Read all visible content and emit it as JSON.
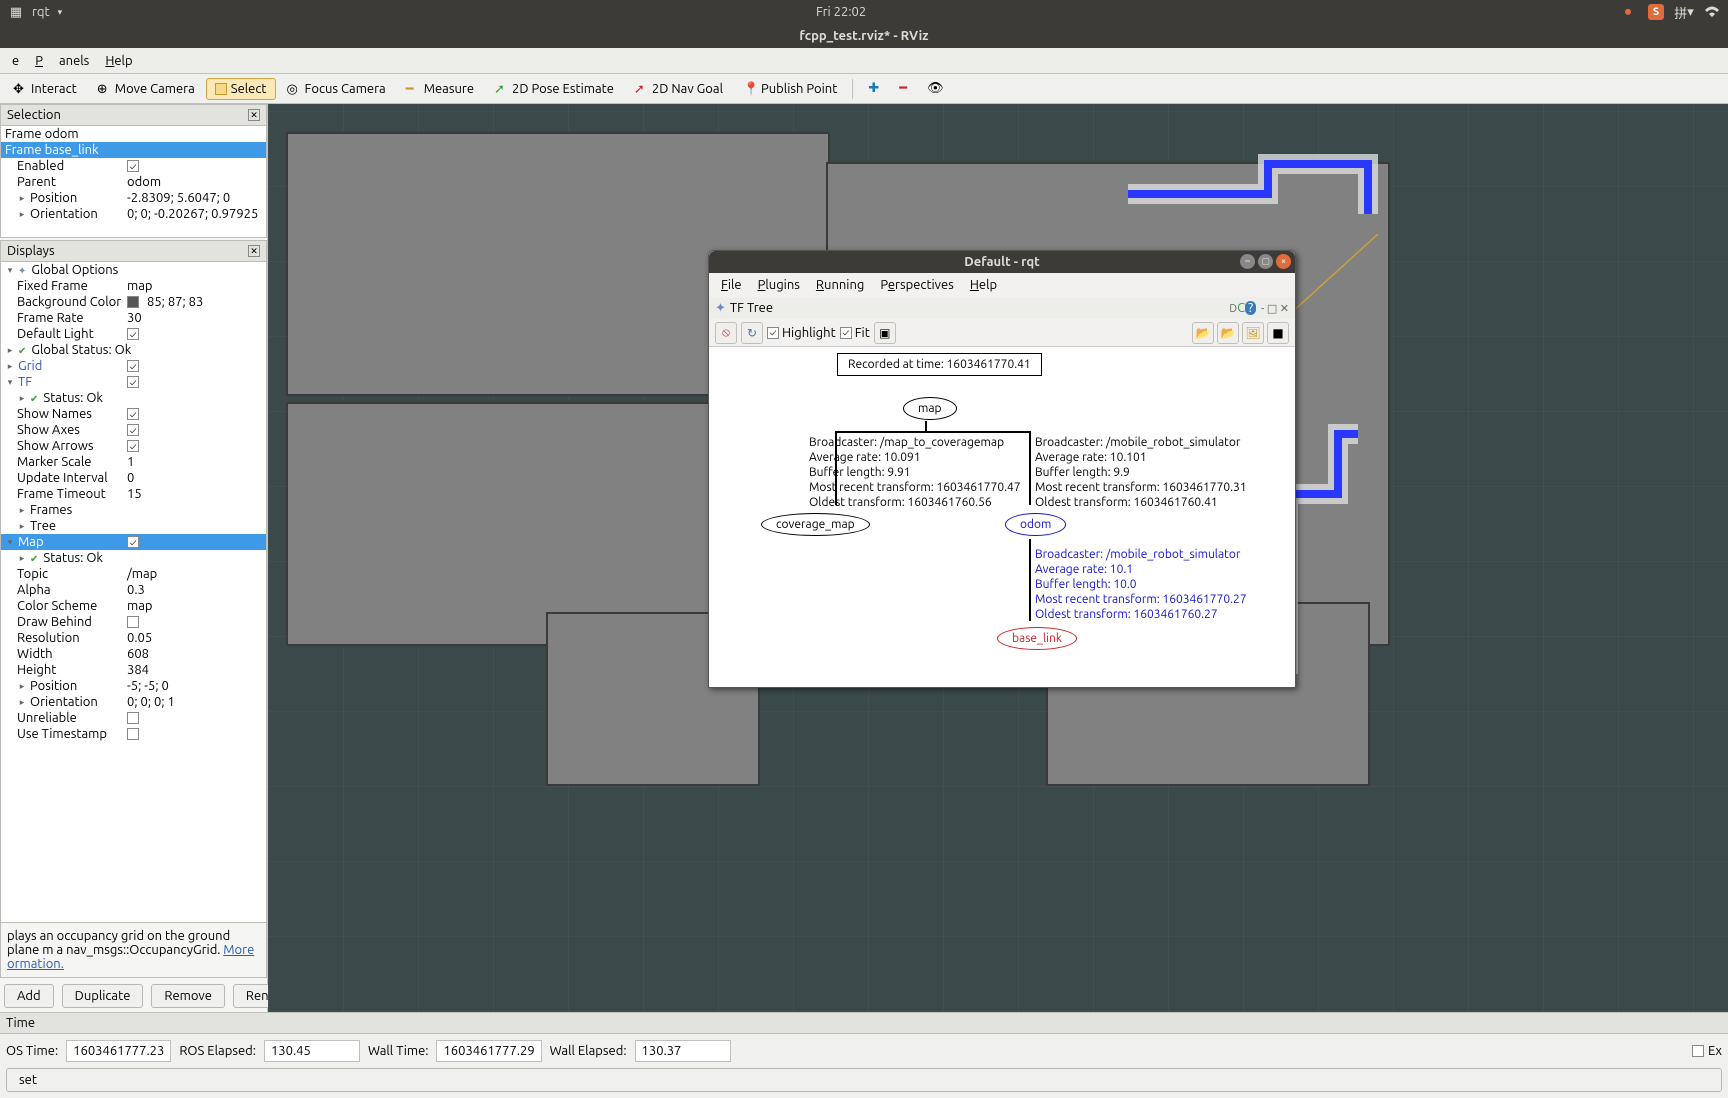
{
  "ubuntu": {
    "app": "rqt",
    "clock": "Fri 22:02",
    "ime": "拼"
  },
  "rviz_title": "fcpp_test.rviz* - RViz",
  "menubar": {
    "file": "e",
    "panels": "Panels",
    "help": "Help"
  },
  "toolbar": {
    "interact": "Interact",
    "move_camera": "Move Camera",
    "select": "Select",
    "focus_camera": "Focus Camera",
    "measure": "Measure",
    "pose_estimate": "2D Pose Estimate",
    "nav_goal": "2D Nav Goal",
    "publish_point": "Publish Point"
  },
  "selection": {
    "title": "Selection",
    "rows": [
      {
        "k": "Frame odom",
        "v": ""
      },
      {
        "k": "Frame base_link",
        "v": "",
        "sel": true
      },
      {
        "k": "Enabled",
        "v": "✓",
        "i": 1,
        "chk": true
      },
      {
        "k": "Parent",
        "v": "odom",
        "i": 1
      },
      {
        "k": "Position",
        "v": "-2.8309; 5.6047; 0",
        "i": 1,
        "exp": "▸"
      },
      {
        "k": "Orientation",
        "v": "0; 0; -0.20267; 0.97925",
        "i": 1,
        "exp": "▸"
      }
    ]
  },
  "displays": {
    "title": "Displays",
    "rows": [
      {
        "k": "Global Options",
        "v": "",
        "exp": "▾",
        "ico": "gear"
      },
      {
        "k": "Fixed Frame",
        "v": "map",
        "i": 1
      },
      {
        "k": "Background Color",
        "v": "85; 87; 83",
        "i": 1,
        "color": true
      },
      {
        "k": "Frame Rate",
        "v": "30",
        "i": 1
      },
      {
        "k": "Default Light",
        "v": "✓",
        "i": 1,
        "chk": true
      },
      {
        "k": "Global Status: Ok",
        "v": "",
        "exp": "▸",
        "ico": "ok"
      },
      {
        "k": "Grid",
        "v": "✓",
        "exp": "▸",
        "chk": true,
        "link": true
      },
      {
        "k": "TF",
        "v": "✓",
        "exp": "▾",
        "chk": true,
        "link": true
      },
      {
        "k": "Status: Ok",
        "v": "",
        "i": 1,
        "exp": "▸",
        "ico": "ok"
      },
      {
        "k": "Show Names",
        "v": "✓",
        "i": 1,
        "chk": true
      },
      {
        "k": "Show Axes",
        "v": "✓",
        "i": 1,
        "chk": true
      },
      {
        "k": "Show Arrows",
        "v": "✓",
        "i": 1,
        "chk": true
      },
      {
        "k": "Marker Scale",
        "v": "1",
        "i": 1
      },
      {
        "k": "Update Interval",
        "v": "0",
        "i": 1
      },
      {
        "k": "Frame Timeout",
        "v": "15",
        "i": 1
      },
      {
        "k": "Frames",
        "v": "",
        "i": 1,
        "exp": "▸"
      },
      {
        "k": "Tree",
        "v": "",
        "i": 1,
        "exp": "▸"
      },
      {
        "k": "Map",
        "v": "✓",
        "exp": "▾",
        "chk": true,
        "sel": true,
        "link": true
      },
      {
        "k": "Status: Ok",
        "v": "",
        "i": 1,
        "exp": "▸",
        "ico": "ok"
      },
      {
        "k": "Topic",
        "v": "/map",
        "i": 1
      },
      {
        "k": "Alpha",
        "v": "0.3",
        "i": 1
      },
      {
        "k": "Color Scheme",
        "v": "map",
        "i": 1
      },
      {
        "k": "Draw Behind",
        "v": "",
        "i": 1,
        "chk": true,
        "unchecked": true
      },
      {
        "k": "Resolution",
        "v": "0.05",
        "i": 1
      },
      {
        "k": "Width",
        "v": "608",
        "i": 1
      },
      {
        "k": "Height",
        "v": "384",
        "i": 1
      },
      {
        "k": "Position",
        "v": "-5; -5; 0",
        "i": 1,
        "exp": "▸"
      },
      {
        "k": "Orientation",
        "v": "0; 0; 0; 1",
        "i": 1,
        "exp": "▸"
      },
      {
        "k": "Unreliable",
        "v": "",
        "i": 1,
        "chk": true,
        "unchecked": true
      },
      {
        "k": "Use Timestamp",
        "v": "",
        "i": 1,
        "chk": true,
        "unchecked": true
      }
    ],
    "desc": "plays an occupancy grid on the ground plane m a nav_msgs::OccupancyGrid.",
    "desc_more": "More ormation.",
    "buttons": {
      "add": "Add",
      "duplicate": "Duplicate",
      "remove": "Remove",
      "rename": "Rename"
    }
  },
  "rqt": {
    "title": "Default - rqt",
    "menu": {
      "file": "File",
      "plugins": "Plugins",
      "running": "Running",
      "perspectives": "Perspectives",
      "help": "Help"
    },
    "subtab": "TF Tree",
    "highlight": "Highlight",
    "fit": "Fit",
    "recorded": "Recorded at time: 1603461770.41",
    "nodes": {
      "map": "map",
      "coverage": "coverage_map",
      "odom": "odom",
      "base": "base_link"
    },
    "edge1": "Broadcaster: /map_to_coveragemap\nAverage rate: 10.091\nBuffer length: 9.91\nMost recent transform: 1603461770.47\nOldest transform: 1603461760.56",
    "edge2": "Broadcaster: /mobile_robot_simulator\nAverage rate: 10.101\nBuffer length: 9.9\nMost recent transform: 1603461770.31\nOldest transform: 1603461760.41",
    "edge3": "Broadcaster: /mobile_robot_simulator\nAverage rate: 10.1\nBuffer length: 10.0\nMost recent transform: 1603461770.27\nOldest transform: 1603461760.27",
    "corner": "DC?"
  },
  "time": {
    "title": "Time",
    "ros_time_l": "OS Time:",
    "ros_time_v": "1603461777.23",
    "ros_elapsed_l": "ROS Elapsed:",
    "ros_elapsed_v": "130.45",
    "wall_time_l": "Wall Time:",
    "wall_time_v": "1603461777.29",
    "wall_elapsed_l": "Wall Elapsed:",
    "wall_elapsed_v": "130.37",
    "exp": "Ex",
    "reset": "set"
  }
}
